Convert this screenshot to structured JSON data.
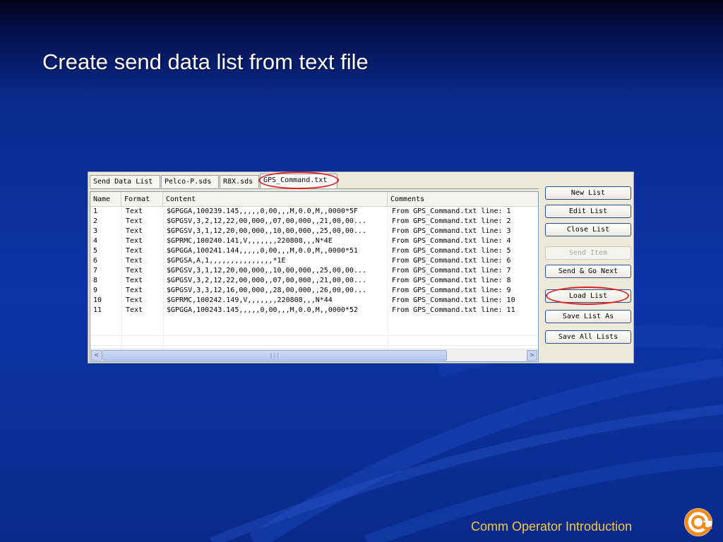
{
  "slide": {
    "title": "Create send data list from text file",
    "footer": "Comm Operator Introduction"
  },
  "colors": {
    "background": "#0d35a8",
    "title": "#ffffff",
    "footer": "#f5c842",
    "highlight_circle": "#e02020"
  },
  "tabs": [
    {
      "label": "Send Data List",
      "active": false
    },
    {
      "label": "Pelco-P.sds",
      "active": false
    },
    {
      "label": "R8X.sds",
      "active": false
    },
    {
      "label": "GPS_Command.txt",
      "active": true
    }
  ],
  "table": {
    "headers": [
      "Name",
      "Format",
      "Content",
      "Comments"
    ],
    "rows": [
      [
        "1",
        "Text",
        "$GPGGA,100239.145,,,,,0,00,,,M,0.0,M,,0000*5F",
        "From GPS_Command.txt line: 1"
      ],
      [
        "2",
        "Text",
        "$GPGSV,3,2,12,22,00,000,,07,00,000,,21,00,00...",
        "From GPS_Command.txt line: 2"
      ],
      [
        "3",
        "Text",
        "$GPGSV,3,1,12,20,00,000,,10,00,000,,25,00,00...",
        "From GPS_Command.txt line: 3"
      ],
      [
        "4",
        "Text",
        "$GPRMC,100240.141,V,,,,,,,220808,,,N*4E",
        "From GPS_Command.txt line: 4"
      ],
      [
        "5",
        "Text",
        "$GPGGA,100241.144,,,,,0,00,,,M,0.0,M,,0000*51",
        "From GPS_Command.txt line: 5"
      ],
      [
        "6",
        "Text",
        "$GPGSA,A,1,,,,,,,,,,,,,,,*1E",
        "From GPS_Command.txt line: 6"
      ],
      [
        "7",
        "Text",
        "$GPGSV,3,1,12,20,00,000,,10,00,000,,25,00,00...",
        "From GPS_Command.txt line: 7"
      ],
      [
        "8",
        "Text",
        "$GPGSV,3,2,12,22,00,000,,07,00,000,,21,00,00...",
        "From GPS_Command.txt line: 8"
      ],
      [
        "9",
        "Text",
        "$GPGSV,3,3,12,16,00,000,,28,00,000,,26,00,00...",
        "From GPS_Command.txt line: 9"
      ],
      [
        "10",
        "Text",
        "$GPRMC,100242.149,V,,,,,,,220808,,,N*44",
        "From GPS_Command.txt line: 10"
      ],
      [
        "11",
        "Text",
        "$GPGGA,100243.145,,,,,0,00,,,M,0.0,M,,0000*52",
        "From GPS_Command.txt line: 11"
      ]
    ]
  },
  "buttons": {
    "new_list": "New List",
    "edit_list": "Edit List",
    "close_list": "Close List",
    "send_item": "Send Item",
    "send_go_next": "Send & Go Next",
    "load_list": "Load List",
    "save_list_as": "Save List As",
    "save_all_lists": "Save All Lists"
  },
  "scrollbar": {
    "left": "<",
    "right": ">",
    "grip": "|||"
  }
}
